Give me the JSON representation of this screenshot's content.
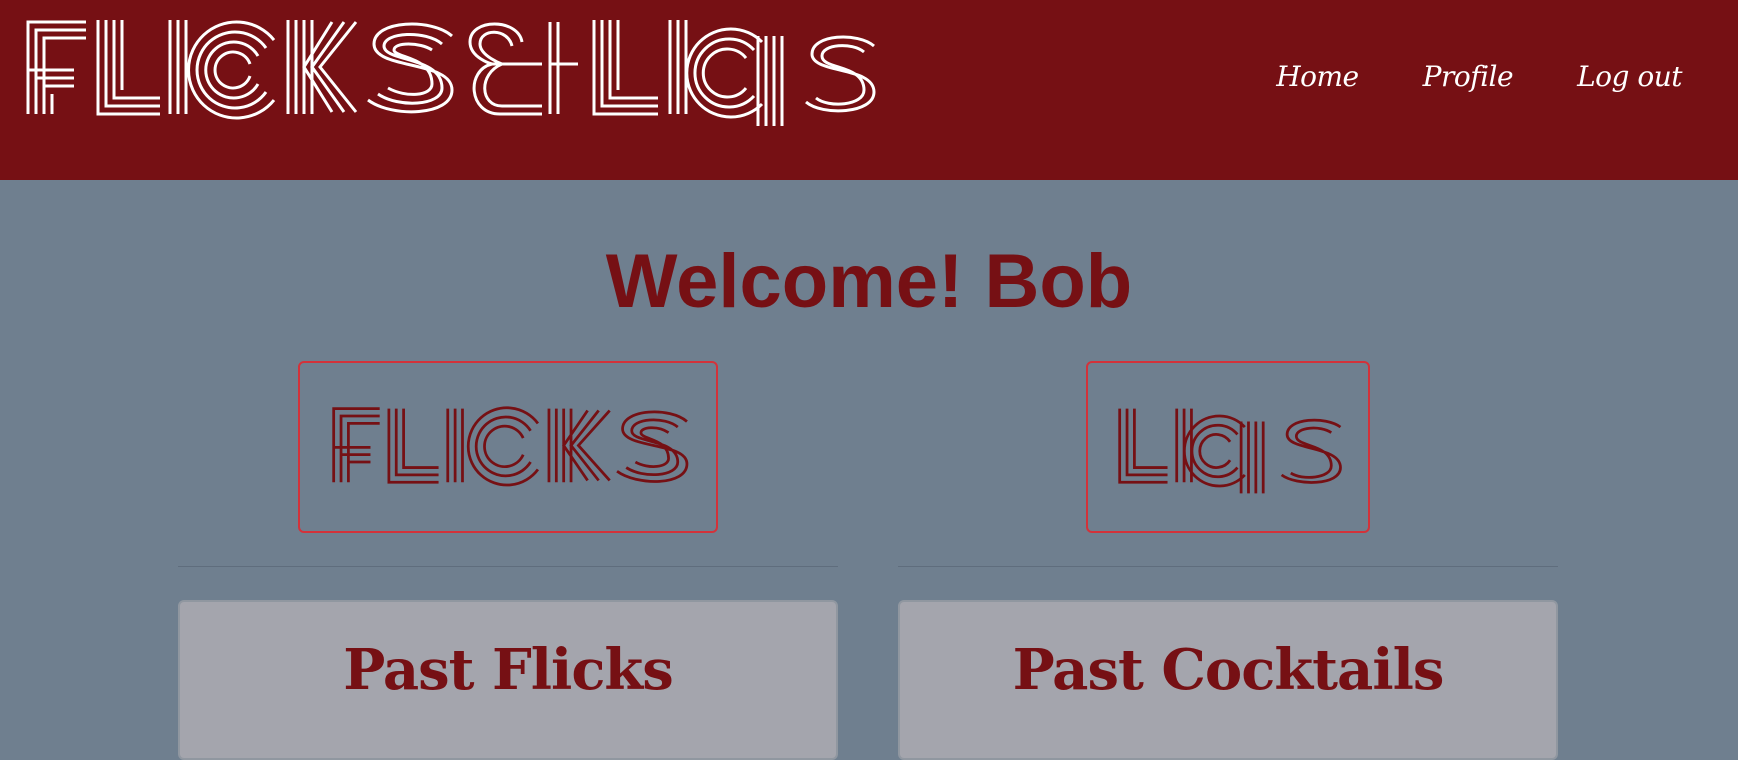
{
  "header": {
    "brand": "Flicks & Liqs",
    "nav": {
      "home": "Home",
      "profile": "Profile",
      "logout": "Log out"
    }
  },
  "main": {
    "welcome": "Welcome! Bob",
    "flicks_logo": "Flicks",
    "liqs_logo": "Liqs",
    "past_flicks_title": "Past Flicks",
    "past_cocktails_title": "Past Cocktails"
  },
  "colors": {
    "navbar": "#761014",
    "page_background": "#6f7f8f",
    "accent_text": "#761014",
    "logo_border": "#d3323a",
    "card_background": "#a4a5ad"
  }
}
